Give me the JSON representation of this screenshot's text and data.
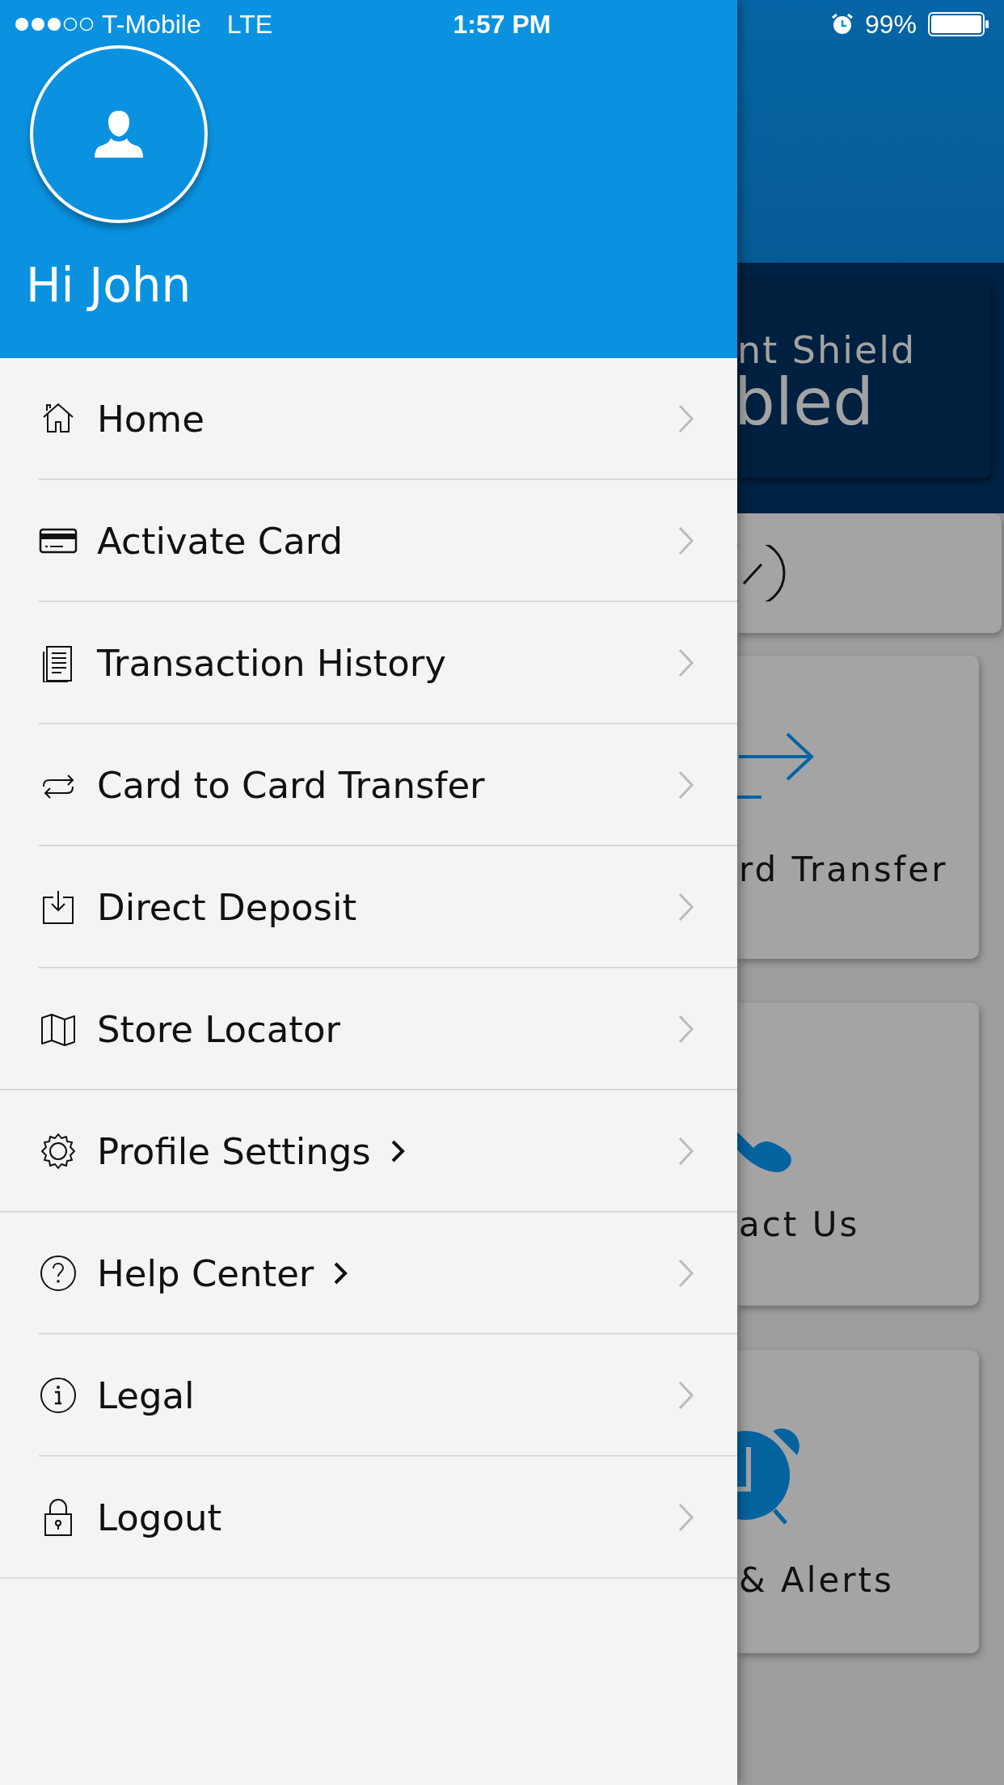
{
  "status_bar": {
    "carrier": "T-Mobile",
    "network": "LTE",
    "time": "1:57 PM",
    "battery": "99%"
  },
  "drawer": {
    "greeting": "Hi John",
    "sections": [
      {
        "items": [
          {
            "label": "Home",
            "submenu": false
          },
          {
            "label": "Activate Card",
            "submenu": false
          },
          {
            "label": "Transaction History",
            "submenu": false
          },
          {
            "label": "Card to Card Transfer",
            "submenu": false
          },
          {
            "label": "Direct Deposit",
            "submenu": false
          },
          {
            "label": "Store Locator",
            "submenu": false
          }
        ]
      },
      {
        "items": [
          {
            "label": "Profile Settings",
            "submenu": true
          }
        ]
      },
      {
        "items": [
          {
            "label": "Help Center",
            "submenu": true
          },
          {
            "label": "Legal",
            "submenu": false
          },
          {
            "label": "Logout",
            "submenu": false
          }
        ]
      }
    ]
  },
  "background_screen": {
    "banner": {
      "line_1": "nt Shield",
      "line_2": "bled"
    },
    "tiles": [
      {
        "kind": "check"
      },
      {
        "kind": "transfer",
        "label": "rd Transfer"
      },
      {
        "kind": "contact",
        "label": "act Us"
      },
      {
        "kind": "alerts",
        "label": "& Alerts"
      }
    ]
  }
}
